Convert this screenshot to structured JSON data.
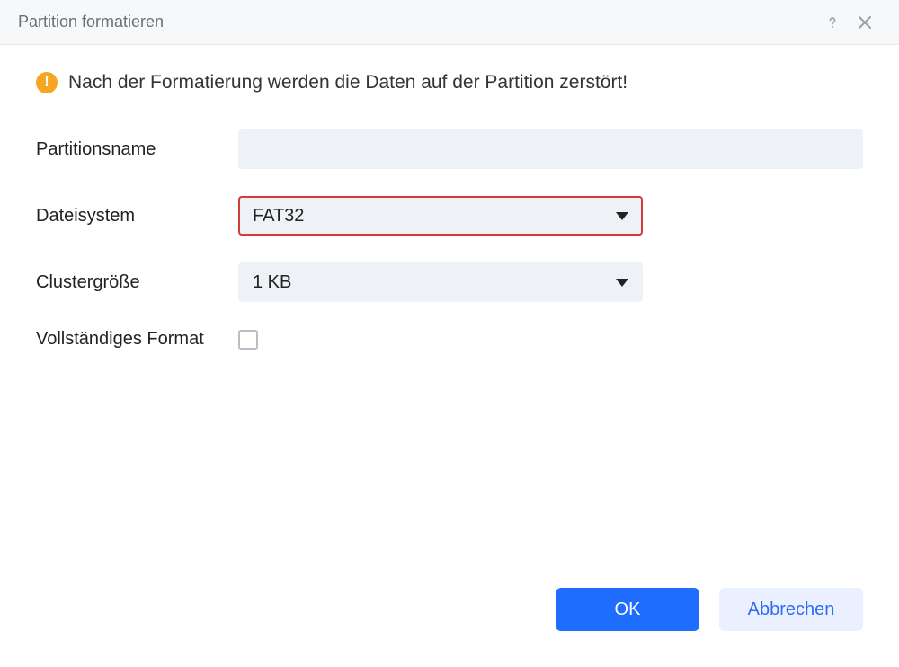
{
  "window": {
    "title": "Partition formatieren"
  },
  "warning": {
    "text": "Nach der Formatierung werden die Daten auf der Partition zerstört!"
  },
  "labels": {
    "partitionsname": "Partitionsname",
    "dateisystem": "Dateisystem",
    "clustergroesse": "Clustergröße",
    "vollstaendiges_format": "Vollständiges Format"
  },
  "fields": {
    "partitionsname_value": "",
    "dateisystem_value": "FAT32",
    "clustergroesse_value": "1 KB",
    "vollstaendiges_format_checked": false
  },
  "buttons": {
    "ok": "OK",
    "cancel": "Abbrechen"
  }
}
